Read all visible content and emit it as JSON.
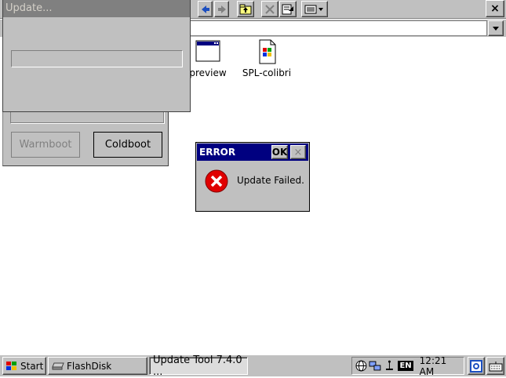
{
  "update_window": {
    "title": "Update...",
    "progress": 0
  },
  "restart_panel": {
    "warmboot_label": "Warmboot",
    "coldboot_label": "Coldboot"
  },
  "explorer": {
    "close_label": "×",
    "address_value": "",
    "files": [
      {
        "name": "preview",
        "icon": "window-icon"
      },
      {
        "name": "SPL-colibri",
        "icon": "windows-file-icon"
      }
    ]
  },
  "error_dialog": {
    "title": "ERROR",
    "ok_label": "OK",
    "close_label": "×",
    "message": "Update Failed.",
    "icon": "error-icon"
  },
  "taskbar": {
    "start_label": "Start",
    "tasks": [
      {
        "label": "FlashDisk"
      },
      {
        "label": "Update Tool 7.4.0 ..."
      }
    ],
    "tray": {
      "language": "EN",
      "clock": "12:21 AM"
    }
  },
  "colors": {
    "window_face": "#c0c0c0",
    "active_title": "#000080",
    "inactive_title": "#808080",
    "error_red": "#e00000"
  }
}
